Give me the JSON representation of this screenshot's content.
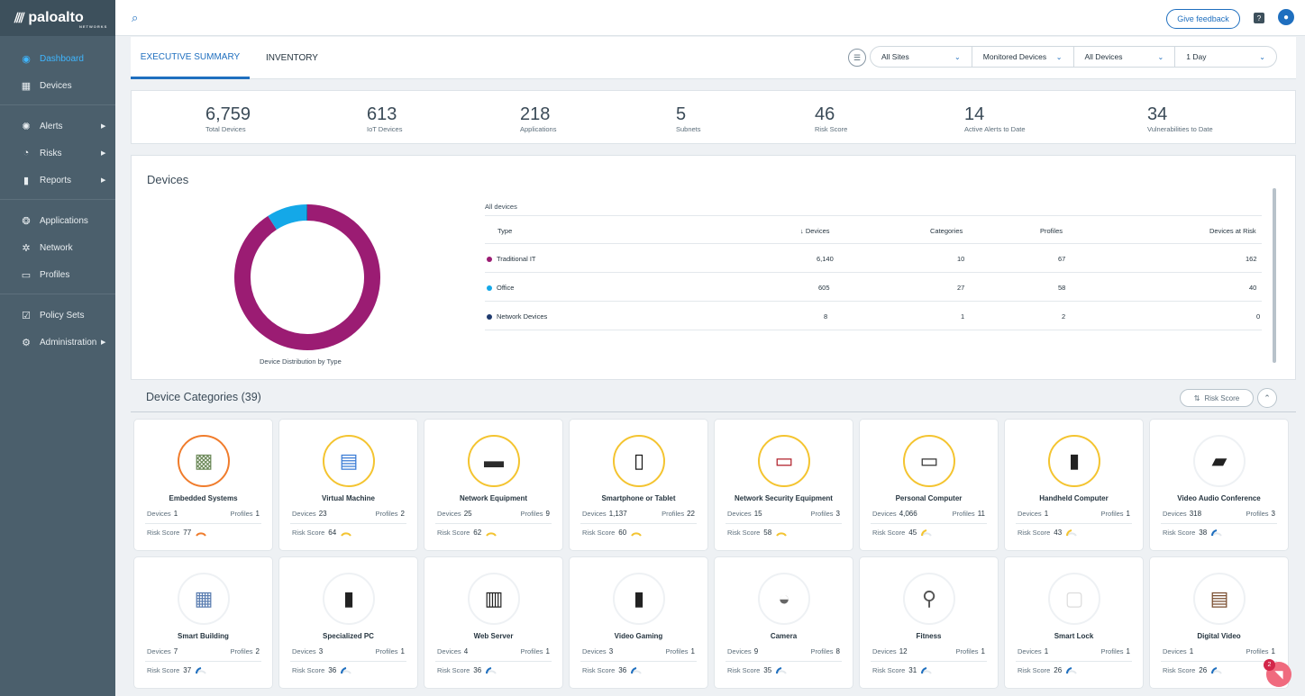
{
  "brand": {
    "name": "paloalto",
    "sub": "NETWORKS"
  },
  "sidebar": {
    "items": [
      {
        "label": "Dashboard",
        "icon": "dashboard-icon",
        "active": true
      },
      {
        "label": "Devices",
        "icon": "devices-icon"
      },
      {
        "label": "Alerts",
        "icon": "alerts-icon"
      },
      {
        "label": "Risks",
        "icon": "risks-icon"
      },
      {
        "label": "Reports",
        "icon": "reports-icon"
      },
      {
        "label": "Applications",
        "icon": "applications-icon"
      },
      {
        "label": "Network",
        "icon": "network-icon"
      },
      {
        "label": "Profiles",
        "icon": "profiles-icon"
      },
      {
        "label": "Policy Sets",
        "icon": "policy-sets-icon"
      },
      {
        "label": "Administration",
        "icon": "administration-icon"
      }
    ]
  },
  "topbar": {
    "feedback_label": "Give feedback"
  },
  "tabs": [
    {
      "label": "EXECUTIVE SUMMARY",
      "active": true
    },
    {
      "label": "INVENTORY"
    }
  ],
  "filters": [
    "All Sites",
    "Monitored Devices",
    "All Devices",
    "1 Day"
  ],
  "stats": [
    {
      "value": "6,759",
      "label": "Total Devices"
    },
    {
      "value": "613",
      "label": "IoT Devices"
    },
    {
      "value": "218",
      "label": "Applications"
    },
    {
      "value": "5",
      "label": "Subnets"
    },
    {
      "value": "46",
      "label": "Risk Score"
    },
    {
      "value": "14",
      "label": "Active Alerts to Date"
    },
    {
      "value": "34",
      "label": "Vulnerabilities to Date"
    }
  ],
  "devices_card": {
    "title": "Devices",
    "chart_label": "Device Distribution by Type",
    "table_caption": "All devices",
    "headers": {
      "type": "Type",
      "devices": "↓ Devices",
      "categories": "Categories",
      "profiles": "Profiles",
      "at_risk": "Devices at Risk"
    },
    "rows": [
      {
        "type": "Traditional IT",
        "devices": "6,140",
        "categories": "10",
        "profiles": "67",
        "at_risk": "162",
        "color": "#9b1c73"
      },
      {
        "type": "Office",
        "devices": "605",
        "categories": "27",
        "profiles": "58",
        "at_risk": "40",
        "color": "#14a8e8"
      },
      {
        "type": "Network Devices",
        "devices": "8",
        "categories": "1",
        "profiles": "2",
        "at_risk": "0",
        "color": "#1f3a6e"
      }
    ]
  },
  "chart_data": {
    "type": "pie",
    "categories": [
      "Traditional IT",
      "Office",
      "Network Devices"
    ],
    "values": [
      6140,
      605,
      8
    ],
    "colors": [
      "#9b1c73",
      "#14a8e8",
      "#1f3a6e"
    ],
    "title": ""
  },
  "categories_section": {
    "title": "Device Categories (39)",
    "sort_label": "Risk Score",
    "devices_label": "Devices",
    "profiles_label": "Profiles",
    "risk_label": "Risk Score",
    "items": [
      {
        "name": "Embedded Systems",
        "devices": "1",
        "profiles": "1",
        "risk": "77",
        "ring": "orange"
      },
      {
        "name": "Virtual Machine",
        "devices": "23",
        "profiles": "2",
        "risk": "64",
        "ring": "yellow"
      },
      {
        "name": "Network Equipment",
        "devices": "25",
        "profiles": "9",
        "risk": "62",
        "ring": "yellow"
      },
      {
        "name": "Smartphone or Tablet",
        "devices": "1,137",
        "profiles": "22",
        "risk": "60",
        "ring": "yellow"
      },
      {
        "name": "Network Security Equipment",
        "devices": "15",
        "profiles": "3",
        "risk": "58",
        "ring": "yellow"
      },
      {
        "name": "Personal Computer",
        "devices": "4,066",
        "profiles": "11",
        "risk": "45",
        "ring": "yellow"
      },
      {
        "name": "Handheld Computer",
        "devices": "1",
        "profiles": "1",
        "risk": "43",
        "ring": "yellow"
      },
      {
        "name": "Video Audio Conference",
        "devices": "318",
        "profiles": "3",
        "risk": "38",
        "ring": "gray"
      },
      {
        "name": "Smart Building",
        "devices": "7",
        "profiles": "2",
        "risk": "37",
        "ring": "gray"
      },
      {
        "name": "Specialized PC",
        "devices": "3",
        "profiles": "1",
        "risk": "36",
        "ring": "gray"
      },
      {
        "name": "Web Server",
        "devices": "4",
        "profiles": "1",
        "risk": "36",
        "ring": "gray"
      },
      {
        "name": "Video Gaming",
        "devices": "3",
        "profiles": "1",
        "risk": "36",
        "ring": "gray"
      },
      {
        "name": "Camera",
        "devices": "9",
        "profiles": "8",
        "risk": "35",
        "ring": "gray"
      },
      {
        "name": "Fitness",
        "devices": "12",
        "profiles": "1",
        "risk": "31",
        "ring": "gray"
      },
      {
        "name": "Smart Lock",
        "devices": "1",
        "profiles": "1",
        "risk": "26",
        "ring": "gray"
      },
      {
        "name": "Digital Video",
        "devices": "1",
        "profiles": "1",
        "risk": "26",
        "ring": "gray"
      }
    ]
  },
  "chat": {
    "badge": "2"
  }
}
